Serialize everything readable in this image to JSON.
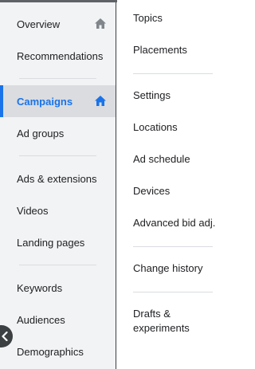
{
  "left_nav": {
    "items": [
      {
        "label": "Overview",
        "icon": "home-icon"
      },
      {
        "label": "Recommendations"
      },
      {
        "label": "Campaigns",
        "icon": "home-icon",
        "active": true
      },
      {
        "label": "Ad groups"
      },
      {
        "label": "Ads & extensions"
      },
      {
        "label": "Videos"
      },
      {
        "label": "Landing pages"
      },
      {
        "label": "Keywords"
      },
      {
        "label": "Audiences"
      },
      {
        "label": "Demographics"
      }
    ]
  },
  "right_nav": {
    "items": [
      {
        "label": "Topics"
      },
      {
        "label": "Placements"
      },
      {
        "label": "Settings"
      },
      {
        "label": "Locations"
      },
      {
        "label": "Ad schedule"
      },
      {
        "label": "Devices"
      },
      {
        "label": "Advanced bid adj."
      },
      {
        "label": "Change history"
      },
      {
        "label": "Drafts & experiments"
      }
    ]
  },
  "colors": {
    "accent": "#1a73e8",
    "sidebar_bg": "#f1f3f4",
    "active_bg": "#dadce0"
  },
  "collapse_toggle": {
    "icon": "chevron-left-icon"
  }
}
